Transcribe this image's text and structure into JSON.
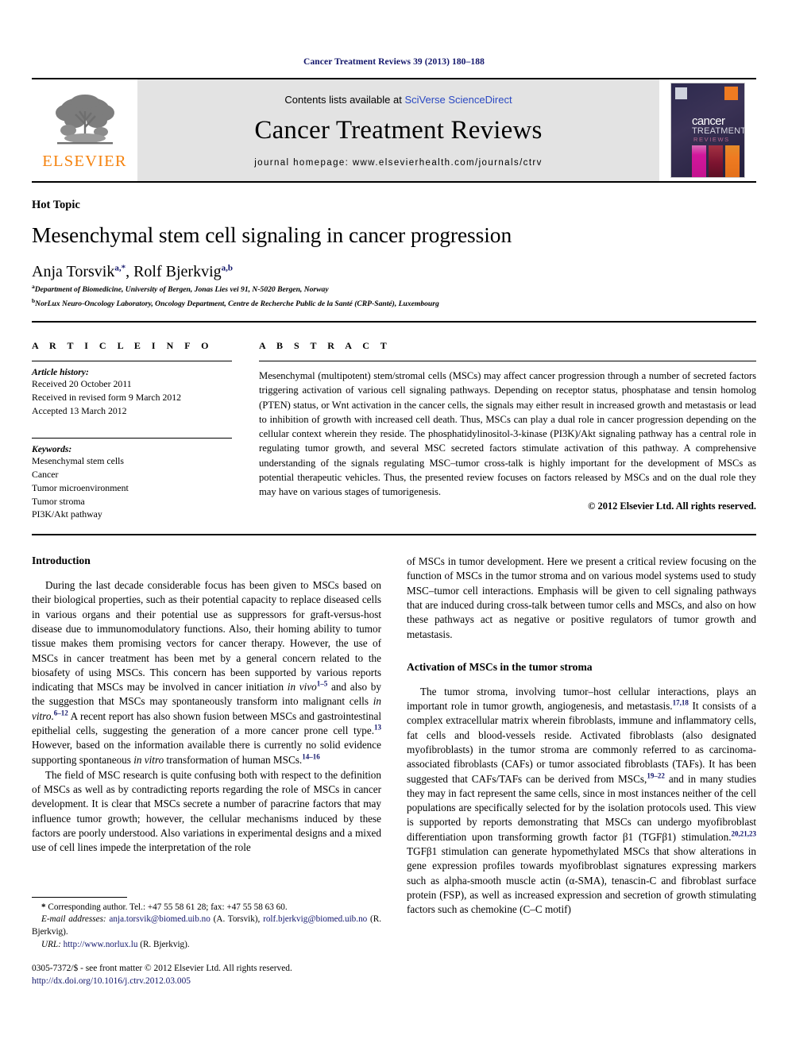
{
  "running_head": "Cancer Treatment Reviews 39 (2013) 180–188",
  "masthead": {
    "contents_prefix": "Contents lists available at ",
    "contents_link": "SciVerse ScienceDirect",
    "journal_title": "Cancer Treatment Reviews",
    "homepage": "journal homepage: www.elsevierhealth.com/journals/ctrv",
    "publisher_word": "ELSEVIER",
    "publisher_color": "#f5820d",
    "cover": {
      "line1": "cancer",
      "line2": "TREATMENT",
      "line3": "REVIEWS",
      "bar_colors": [
        "#d1179c",
        "#7d1430",
        "#ef7b21"
      ]
    }
  },
  "article": {
    "category": "Hot Topic",
    "title": "Mesenchymal stem cell signaling in cancer progression",
    "author_1": "Anja Torsvik",
    "author_1_sup": "a,*",
    "author_sep": ", ",
    "author_2": "Rolf Bjerkvig",
    "author_2_sup": "a,b",
    "affiliation_a_marker": "a",
    "affiliation_a": "Department of Biomedicine, University of Bergen, Jonas Lies vei 91, N-5020 Bergen, Norway",
    "affiliation_b_marker": "b",
    "affiliation_b": "NorLux Neuro-Oncology Laboratory, Oncology Department, Centre de Recherche Public de la Santé (CRP-Santé), Luxembourg"
  },
  "info": {
    "heading": "A R T I C L E   I N F O",
    "history_label": "Article history:",
    "history": [
      "Received 20 October 2011",
      "Received in revised form 9 March 2012",
      "Accepted 13 March 2012"
    ],
    "keywords_label": "Keywords:",
    "keywords": [
      "Mesenchymal stem cells",
      "Cancer",
      "Tumor microenvironment",
      "Tumor stroma",
      "PI3K/Akt pathway"
    ]
  },
  "abstract": {
    "heading": "A B S T R A C T",
    "text": "Mesenchymal (multipotent) stem/stromal cells (MSCs) may affect cancer progression through a number of secreted factors triggering activation of various cell signaling pathways. Depending on receptor status, phosphatase and tensin homolog (PTEN) status, or Wnt activation in the cancer cells, the signals may either result in increased growth and metastasis or lead to inhibition of growth with increased cell death. Thus, MSCs can play a dual role in cancer progression depending on the cellular context wherein they reside. The phosphatidylinositol-3-kinase (PI3K)/Akt signaling pathway has a central role in regulating tumor growth, and several MSC secreted factors stimulate activation of this pathway. A comprehensive understanding of the signals regulating MSC–tumor cross-talk is highly important for the development of MSCs as potential therapeutic vehicles. Thus, the presented review focuses on factors released by MSCs and on the dual role they may have on various stages of tumorigenesis.",
    "copyright": "© 2012 Elsevier Ltd. All rights reserved."
  },
  "body": {
    "intro_heading": "Introduction",
    "intro_p1_a": "During the last decade considerable focus has been given to MSCs based on their biological properties, such as their potential capacity to replace diseased cells in various organs and their potential use as suppressors for graft-versus-host disease due to immunomodulatory functions. Also, their homing ability to tumor tissue makes them promising vectors for cancer therapy. However, the use of MSCs in cancer treatment has been met by a general concern related to the biosafety of using MSCs. This concern has been supported by various reports indicating that MSCs may be involved in cancer initiation ",
    "intro_p1_it1": "in vivo",
    "intro_p1_cite1": "1–5",
    "intro_p1_b": " and also by the suggestion that MSCs may spontaneously transform into malignant cells ",
    "intro_p1_it2": "in vitro",
    "intro_p1_cite2": "6–12",
    "intro_p1_c": " A recent report has also shown fusion between MSCs and gastrointestinal epithelial cells, suggesting the generation of a more cancer prone cell type.",
    "intro_p1_cite3": "13",
    "intro_p1_d": " However, based on the information available there is currently no solid evidence supporting spontaneous ",
    "intro_p1_it3": "in vitro",
    "intro_p1_e": " transformation of human MSCs.",
    "intro_p1_cite4": "14–16",
    "intro_p2": "The field of MSC research is quite confusing both with respect to the definition of MSCs as well as by contradicting reports regarding the role of MSCs in cancer development. It is clear that MSCs secrete a number of paracrine factors that may influence tumor growth; however, the cellular mechanisms induced by these factors are poorly understood. Also variations in experimental designs and a mixed use of cell lines impede the interpretation of the role",
    "col2_p1": "of MSCs in tumor development. Here we present a critical review focusing on the function of MSCs in the tumor stroma and on various model systems used to study MSC–tumor cell interactions. Emphasis will be given to cell signaling pathways that are induced during cross-talk between tumor cells and MSCs, and also on how these pathways act as negative or positive regulators of tumor growth and metastasis.",
    "activation_heading": "Activation of MSCs in the tumor stroma",
    "act_p_a": "The tumor stroma, involving tumor–host cellular interactions, plays an important role in tumor growth, angiogenesis, and metastasis.",
    "act_cite1": "17,18",
    "act_p_b": " It consists of a complex extracellular matrix wherein fibroblasts, immune and inflammatory cells, fat cells and blood-vessels reside. Activated fibroblasts (also designated myofibroblasts) in the tumor stroma are commonly referred to as carcinoma-associated fibroblasts (CAFs) or tumor associated fibroblasts (TAFs). It has been suggested that CAFs/TAFs can be derived from MSCs,",
    "act_cite2": "19–22",
    "act_p_c": " and in many studies they may in fact represent the same cells, since in most instances neither of the cell populations are specifically selected for by the isolation protocols used. This view is supported by reports demonstrating that MSCs can undergo myofibroblast differentiation upon transforming growth factor β1 (TGFβ1) stimulation.",
    "act_cite3": "20,21,23",
    "act_p_d": " TGFβ1 stimulation can generate hypomethylated MSCs that show alterations in gene expression profiles towards myofibroblast signatures expressing markers such as alpha-smooth muscle actin (α-SMA), tenascin-C and fibroblast surface protein (FSP), as well as increased expression and secretion of growth stimulating factors such as chemokine (C–C motif)"
  },
  "footnotes": {
    "corresponding_marker": "*",
    "corresponding": " Corresponding author. Tel.: +47 55 58 61 28; fax: +47 55 58 63 60.",
    "email_label": "E-mail addresses:",
    "email_1": "anja.torsvik@biomed.uib.no",
    "email_1_name": " (A. Torsvik), ",
    "email_2": "rolf.bjerkvig@biomed.uib.no",
    "email_2_name": " (R. Bjerkvig).",
    "url_label": "URL:",
    "url": "http://www.norlux.lu",
    "url_name": " (R. Bjerkvig).",
    "issn_line": "0305-7372/$ - see front matter © 2012 Elsevier Ltd. All rights reserved.",
    "doi": "http://dx.doi.org/10.1016/j.ctrv.2012.03.005"
  }
}
